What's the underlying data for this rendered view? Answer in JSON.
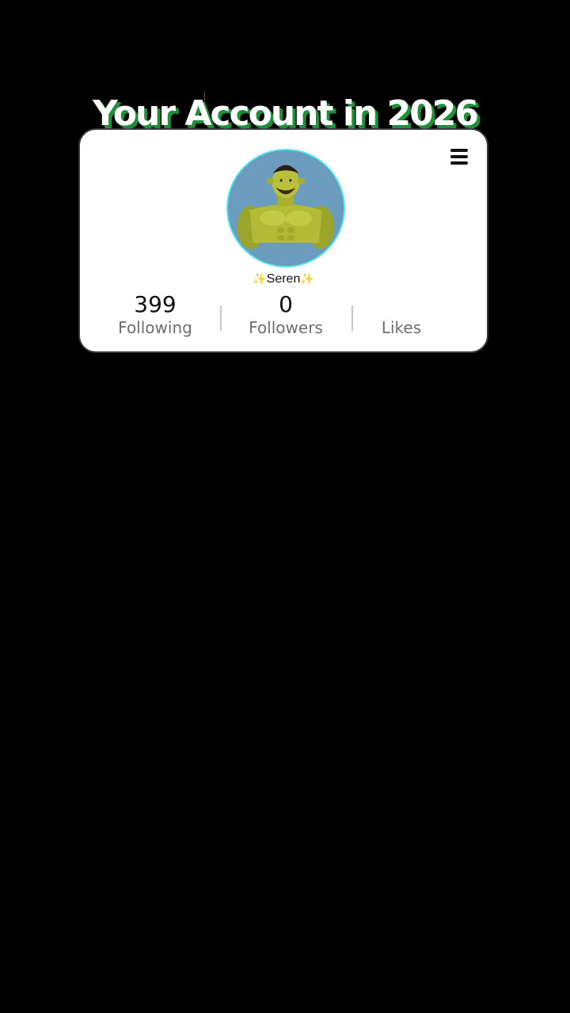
{
  "headline": "Your Account in 2026",
  "profile": {
    "username": "Seren",
    "sparkle": "✨",
    "avatar_icon": "muscular-green-ogre-avatar"
  },
  "stats": {
    "following": {
      "value": "399",
      "label": "Following"
    },
    "followers": {
      "value": "0",
      "label": "Followers"
    },
    "likes": {
      "value": "",
      "label": "Likes"
    }
  },
  "menu_icon": "hamburger-menu-icon",
  "colors": {
    "background": "#000000",
    "card": "#ffffff",
    "headline_shadow": "#1f8f3a",
    "avatar_ring": "#54e8f0",
    "avatar_bg": "#6c9cbd",
    "label_gray": "#6e6e6e"
  }
}
